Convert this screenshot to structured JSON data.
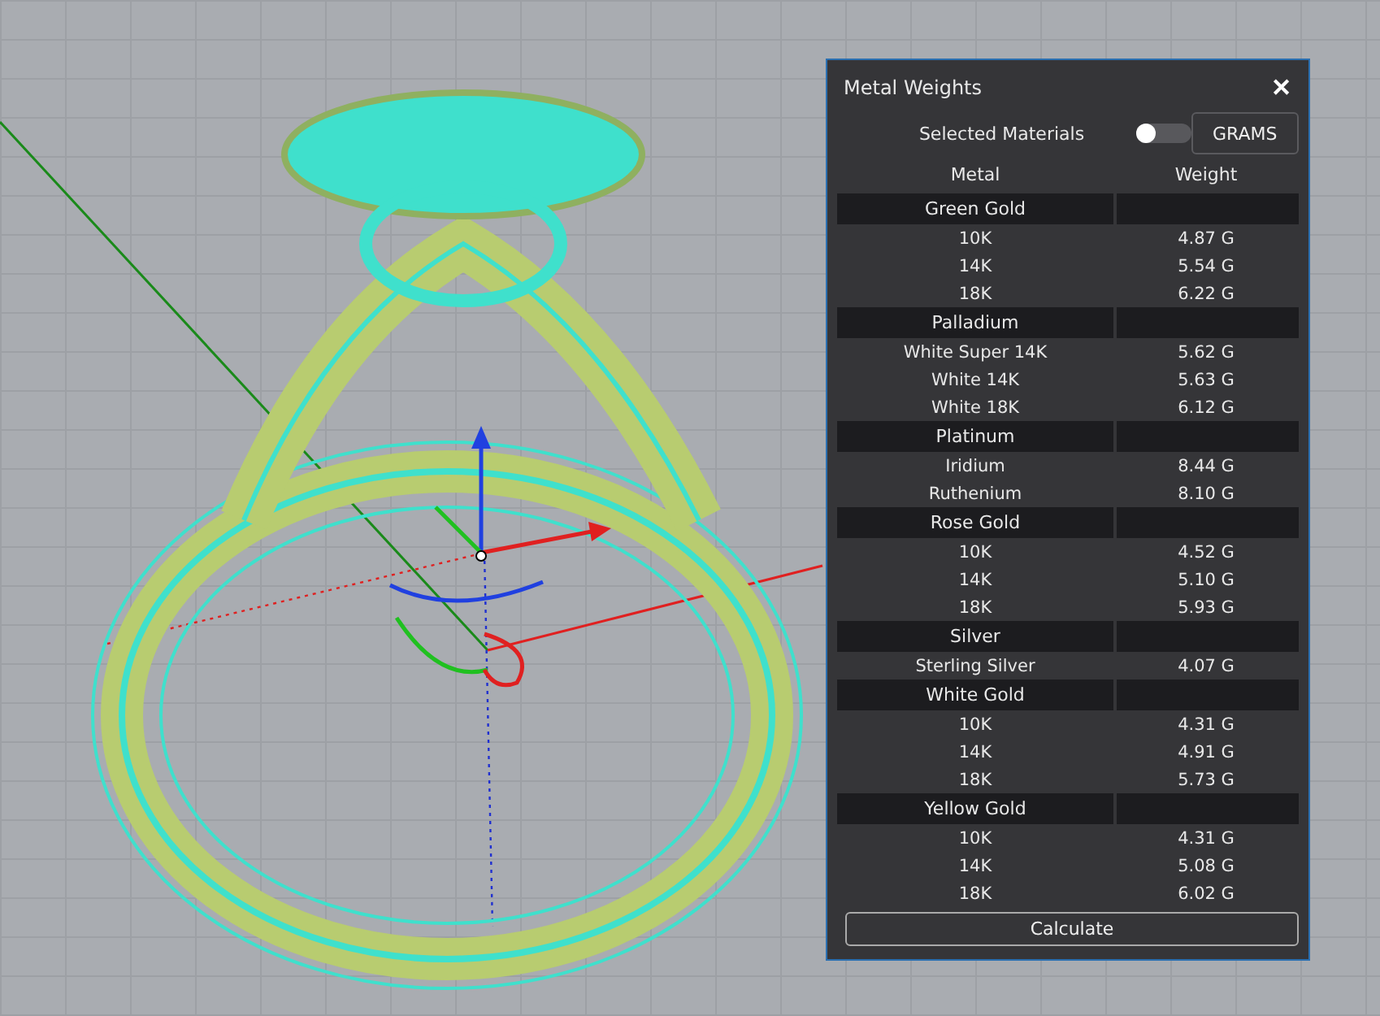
{
  "panel": {
    "title": "Metal Weights",
    "close": "✕",
    "toggle": {
      "label": "Selected Materials",
      "on": false
    },
    "units_button": "GRAMS",
    "columns": [
      "Metal",
      "Weight"
    ],
    "groups": [
      {
        "name": "Green Gold",
        "items": [
          {
            "metal": "10K",
            "weight": "4.87 G"
          },
          {
            "metal": "14K",
            "weight": "5.54 G"
          },
          {
            "metal": "18K",
            "weight": "6.22 G"
          }
        ]
      },
      {
        "name": "Palladium",
        "items": [
          {
            "metal": "White Super 14K",
            "weight": "5.62 G"
          },
          {
            "metal": "White 14K",
            "weight": "5.63 G"
          },
          {
            "metal": "White 18K",
            "weight": "6.12 G"
          }
        ]
      },
      {
        "name": "Platinum",
        "items": [
          {
            "metal": "Iridium",
            "weight": "8.44 G"
          },
          {
            "metal": "Ruthenium",
            "weight": "8.10 G"
          }
        ]
      },
      {
        "name": "Rose Gold",
        "items": [
          {
            "metal": "10K",
            "weight": "4.52 G"
          },
          {
            "metal": "14K",
            "weight": "5.10 G"
          },
          {
            "metal": "18K",
            "weight": "5.93 G"
          }
        ]
      },
      {
        "name": "Silver",
        "items": [
          {
            "metal": "Sterling Silver",
            "weight": "4.07 G"
          }
        ]
      },
      {
        "name": "White Gold",
        "items": [
          {
            "metal": "10K",
            "weight": "4.31 G"
          },
          {
            "metal": "14K",
            "weight": "4.91 G"
          },
          {
            "metal": "18K",
            "weight": "5.73 G"
          }
        ]
      },
      {
        "name": "Yellow Gold",
        "items": [
          {
            "metal": "10K",
            "weight": "4.31 G"
          },
          {
            "metal": "14K",
            "weight": "5.08 G"
          },
          {
            "metal": "18K",
            "weight": "6.02 G"
          }
        ]
      }
    ],
    "calculate_button": "Calculate"
  }
}
